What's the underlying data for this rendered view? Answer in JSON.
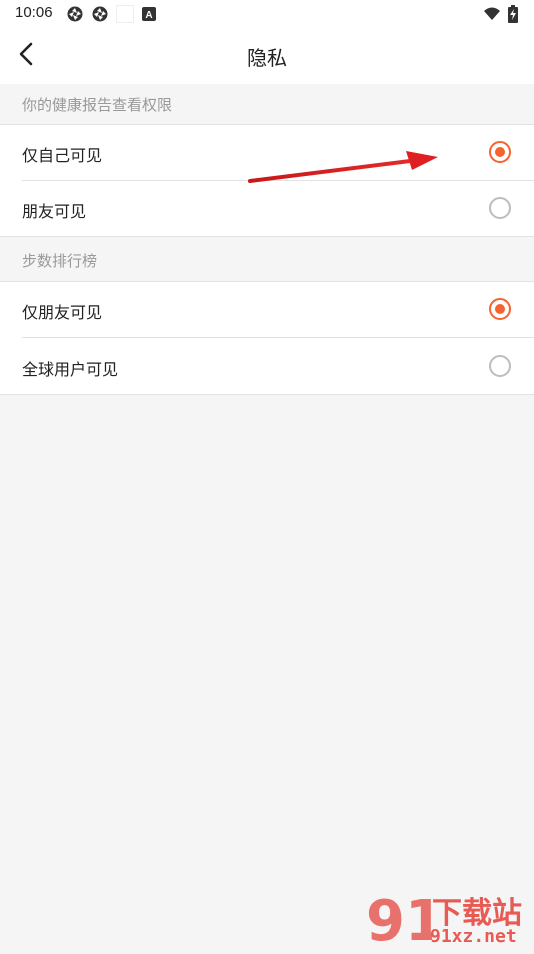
{
  "status_bar": {
    "time": "10:06",
    "notification_letter": "A",
    "icons": [
      "app-notification-icon",
      "app-notification-icon",
      "blank-notification-icon",
      "a-notification-icon",
      "wifi-icon",
      "battery-charging-icon"
    ]
  },
  "header": {
    "title": "隐私",
    "back_icon": "chevron-left-icon"
  },
  "sections": [
    {
      "title": "你的健康报告查看权限",
      "options": [
        {
          "label": "仅自己可见",
          "selected": true
        },
        {
          "label": "朋友可见",
          "selected": false
        }
      ]
    },
    {
      "title": "步数排行榜",
      "options": [
        {
          "label": "仅朋友可见",
          "selected": true
        },
        {
          "label": "全球用户可见",
          "selected": false
        }
      ]
    }
  ],
  "colors": {
    "accent": "#f7632f",
    "background": "#f5f5f5",
    "annotation_arrow": "#e02020",
    "watermark": "#e85b55"
  },
  "watermark": {
    "logo_number": "91",
    "main": "下载站",
    "sub": "91xz.net"
  }
}
